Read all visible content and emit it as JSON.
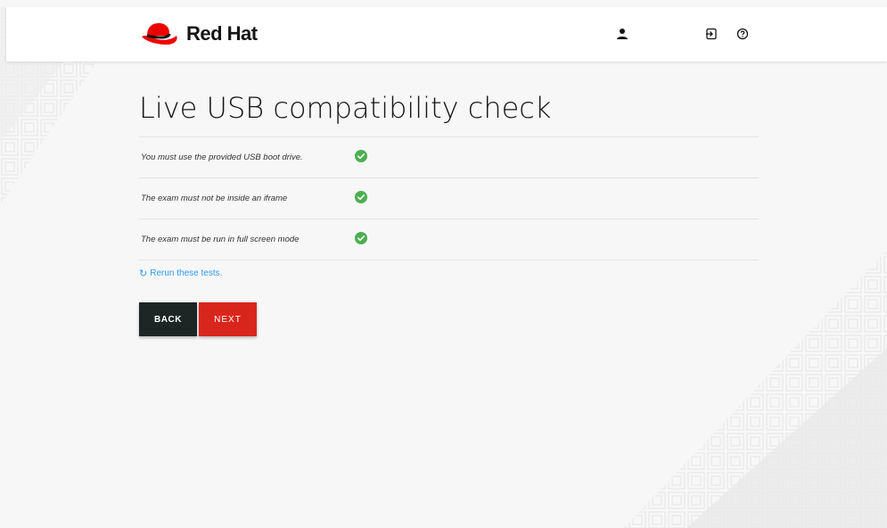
{
  "header": {
    "brand": "Red Hat",
    "icons": [
      "user-icon",
      "logout-icon",
      "help-icon"
    ]
  },
  "page": {
    "title": "Live USB compatibility check"
  },
  "checks": [
    {
      "label": "You must use the provided USB boot drive.",
      "status": "passed"
    },
    {
      "label": "The exam must not be inside an iframe",
      "status": "passed"
    },
    {
      "label": "The exam must be run in full screen mode",
      "status": "passed"
    }
  ],
  "rerun": {
    "icon": "refresh-icon",
    "label": "Rerun these tests."
  },
  "buttons": {
    "back": "BACK",
    "next": "NEXT"
  },
  "colors": {
    "brand_red": "#ee0000",
    "next_button": "#d8261c",
    "back_button": "#1d2525",
    "check_green": "#4caf50",
    "link_blue": "#2b9af3"
  }
}
